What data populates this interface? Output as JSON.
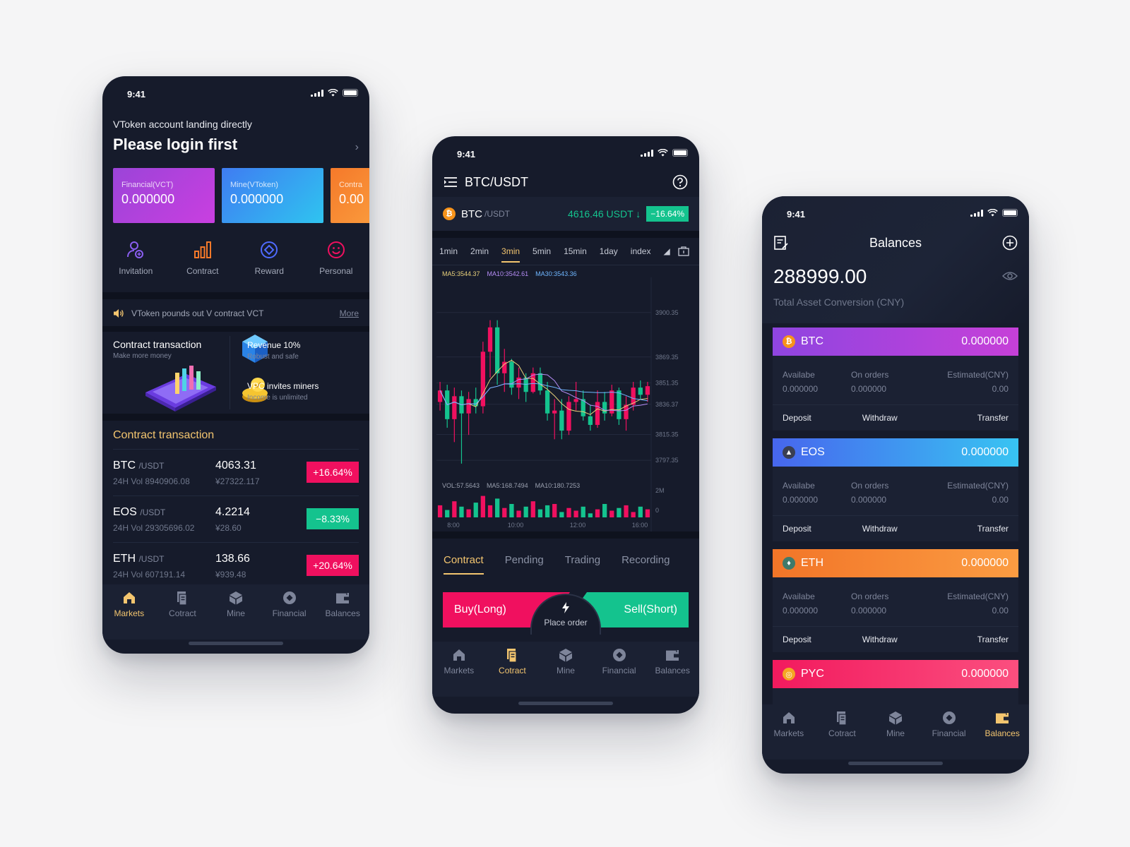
{
  "status_time": "9:41",
  "nav_tabs": [
    "Markets",
    "Cotract",
    "Mine",
    "Financial",
    "Balances"
  ],
  "phone1": {
    "account_prompt": "VToken account landing directly",
    "login_title": "Please login first",
    "accounts": [
      {
        "label": "Financial(VCT)",
        "value": "0.000000"
      },
      {
        "label": "Mine(VToken)",
        "value": "0.000000"
      },
      {
        "label": "Contra",
        "value": "0.00"
      }
    ],
    "shortcuts": [
      "Invitation",
      "Contract",
      "Reward",
      "Personal"
    ],
    "notice": {
      "text": "VToken pounds out V contract VCT",
      "link": "More"
    },
    "promo": {
      "title": "Contract transaction",
      "subtitle": "Make more money",
      "items": [
        {
          "title": "Revenue 10%",
          "subtitle": "Robust and safe"
        },
        {
          "title": "VPC invites miners",
          "subtitle": "Income is unlimited"
        }
      ]
    },
    "section_title": "Contract transaction",
    "markets": [
      {
        "pair": "BTC",
        "quote": "/USDT",
        "volume": "24H Vol 8940906.08",
        "price": "4063.31",
        "cny": "¥27322.117",
        "change": "+16.64%",
        "direction": "up"
      },
      {
        "pair": "EOS",
        "quote": "/USDT",
        "volume": "24H Vol 29305696.02",
        "price": "4.2214",
        "cny": "¥28.60",
        "change": "−8.33%",
        "direction": "down"
      },
      {
        "pair": "ETH",
        "quote": "/USDT",
        "volume": "24H Vol  607191.14",
        "price": "138.66",
        "cny": "¥939.48",
        "change": "+20.64%",
        "direction": "up"
      }
    ],
    "active_tab": "Markets"
  },
  "phone2": {
    "title": "BTC/USDT",
    "ticker": {
      "coin": "BTC",
      "quote": "/USDT",
      "price": "4616.46 USDT ↓",
      "change": "−16.64%"
    },
    "intervals": [
      "1min",
      "2min",
      "3min",
      "5min",
      "15min",
      "1day",
      "index"
    ],
    "active_interval": "3min",
    "ma_labels": [
      "MA5:3544.37",
      "MA10:3542.61",
      "MA30:3543.36"
    ],
    "vol_labels": [
      "VOL:57.5643",
      "MA5:168.7494",
      "MA10:180.7253"
    ],
    "order_tabs": [
      "Contract",
      "Pending",
      "Trading",
      "Recording"
    ],
    "active_order_tab": "Contract",
    "buy_label": "Buy(Long)",
    "sell_label": "Sell(Short)",
    "place_order_label": "Place order",
    "active_tab": "Cotract"
  },
  "phone3": {
    "title": "Balances",
    "total": "288999.00",
    "total_label": "Total Asset Conversion (CNY)",
    "col_labels": [
      "Availabe",
      "On orders",
      "Estimated(CNY)"
    ],
    "action_labels": [
      "Deposit",
      "Withdraw",
      "Transfer"
    ],
    "assets": [
      {
        "coin": "BTC",
        "balance": "0.000000",
        "available": "0.000000",
        "on_orders": "0.000000",
        "estimated": "0.00"
      },
      {
        "coin": "EOS",
        "balance": "0.000000",
        "available": "0.000000",
        "on_orders": "0.000000",
        "estimated": "0.00"
      },
      {
        "coin": "ETH",
        "balance": "0.000000",
        "available": "0.000000",
        "on_orders": "0.000000",
        "estimated": "0.00"
      },
      {
        "coin": "PYC",
        "balance": "0.000000"
      }
    ],
    "active_tab": "Balances"
  },
  "chart_data": {
    "type": "candlestick",
    "y_ticks": [
      "3900.35",
      "3869.35",
      "3851.35",
      "3836.37",
      "3815.35",
      "3797.35"
    ],
    "ylim": [
      3790,
      3915
    ],
    "x_ticks": [
      "8:00",
      "10:00",
      "12:00",
      "16:00"
    ],
    "volume_ticks": [
      "2M",
      "0"
    ],
    "candles": [
      {
        "o": 3838,
        "h": 3852,
        "l": 3832,
        "c": 3846
      },
      {
        "o": 3846,
        "h": 3850,
        "l": 3820,
        "c": 3826
      },
      {
        "o": 3826,
        "h": 3848,
        "l": 3810,
        "c": 3842
      },
      {
        "o": 3842,
        "h": 3846,
        "l": 3795,
        "c": 3830
      },
      {
        "o": 3830,
        "h": 3845,
        "l": 3815,
        "c": 3840
      },
      {
        "o": 3840,
        "h": 3848,
        "l": 3830,
        "c": 3835
      },
      {
        "o": 3835,
        "h": 3880,
        "l": 3830,
        "c": 3873
      },
      {
        "o": 3873,
        "h": 3895,
        "l": 3855,
        "c": 3890
      },
      {
        "o": 3890,
        "h": 3895,
        "l": 3850,
        "c": 3858
      },
      {
        "o": 3858,
        "h": 3875,
        "l": 3845,
        "c": 3866
      },
      {
        "o": 3866,
        "h": 3868,
        "l": 3843,
        "c": 3848
      },
      {
        "o": 3848,
        "h": 3862,
        "l": 3840,
        "c": 3855
      },
      {
        "o": 3855,
        "h": 3858,
        "l": 3838,
        "c": 3845
      },
      {
        "o": 3845,
        "h": 3862,
        "l": 3844,
        "c": 3858
      },
      {
        "o": 3858,
        "h": 3862,
        "l": 3843,
        "c": 3846
      },
      {
        "o": 3846,
        "h": 3852,
        "l": 3825,
        "c": 3830
      },
      {
        "o": 3830,
        "h": 3840,
        "l": 3812,
        "c": 3832
      },
      {
        "o": 3832,
        "h": 3840,
        "l": 3812,
        "c": 3818
      },
      {
        "o": 3818,
        "h": 3842,
        "l": 3815,
        "c": 3838
      },
      {
        "o": 3838,
        "h": 3852,
        "l": 3832,
        "c": 3840
      },
      {
        "o": 3840,
        "h": 3846,
        "l": 3825,
        "c": 3828
      },
      {
        "o": 3828,
        "h": 3836,
        "l": 3818,
        "c": 3822
      },
      {
        "o": 3822,
        "h": 3846,
        "l": 3820,
        "c": 3838
      },
      {
        "o": 3838,
        "h": 3845,
        "l": 3825,
        "c": 3830
      },
      {
        "o": 3830,
        "h": 3850,
        "l": 3828,
        "c": 3846
      },
      {
        "o": 3846,
        "h": 3848,
        "l": 3822,
        "c": 3826
      },
      {
        "o": 3826,
        "h": 3842,
        "l": 3818,
        "c": 3836
      },
      {
        "o": 3836,
        "h": 3852,
        "l": 3832,
        "c": 3848
      },
      {
        "o": 3848,
        "h": 3853,
        "l": 3840,
        "c": 3843
      },
      {
        "o": 3843,
        "h": 3852,
        "l": 3838,
        "c": 3849
      }
    ],
    "volumes": [
      0.9,
      0.55,
      1.2,
      0.8,
      0.6,
      1.1,
      1.6,
      0.9,
      1.4,
      0.7,
      1.0,
      0.5,
      0.8,
      1.2,
      0.6,
      0.9,
      1.0,
      0.4,
      0.7,
      0.5,
      0.8,
      0.3,
      0.6,
      1.0,
      0.5,
      0.7,
      0.9,
      0.4,
      0.8,
      0.6
    ]
  },
  "colors": {
    "up": "#f0105f",
    "down": "#14c38e",
    "accent": "#f3c56f",
    "bg": "#161b2b"
  }
}
